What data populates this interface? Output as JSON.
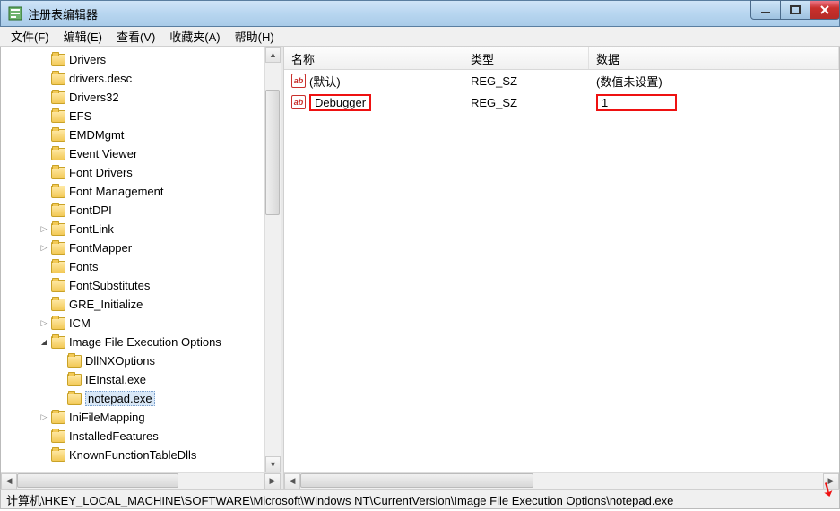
{
  "window": {
    "title": "注册表编辑器"
  },
  "menu": {
    "file": "文件(F)",
    "edit": "编辑(E)",
    "view": "查看(V)",
    "favorites": "收藏夹(A)",
    "help": "帮助(H)"
  },
  "tree": {
    "items": [
      {
        "indent": 2,
        "toggle": "none",
        "label": "Drivers"
      },
      {
        "indent": 2,
        "toggle": "none",
        "label": "drivers.desc"
      },
      {
        "indent": 2,
        "toggle": "none",
        "label": "Drivers32"
      },
      {
        "indent": 2,
        "toggle": "none",
        "label": "EFS"
      },
      {
        "indent": 2,
        "toggle": "none",
        "label": "EMDMgmt"
      },
      {
        "indent": 2,
        "toggle": "none",
        "label": "Event Viewer"
      },
      {
        "indent": 2,
        "toggle": "none",
        "label": "Font Drivers"
      },
      {
        "indent": 2,
        "toggle": "none",
        "label": "Font Management"
      },
      {
        "indent": 2,
        "toggle": "none",
        "label": "FontDPI"
      },
      {
        "indent": 2,
        "toggle": "collapsed",
        "label": "FontLink"
      },
      {
        "indent": 2,
        "toggle": "collapsed",
        "label": "FontMapper"
      },
      {
        "indent": 2,
        "toggle": "none",
        "label": "Fonts"
      },
      {
        "indent": 2,
        "toggle": "none",
        "label": "FontSubstitutes"
      },
      {
        "indent": 2,
        "toggle": "none",
        "label": "GRE_Initialize"
      },
      {
        "indent": 2,
        "toggle": "collapsed",
        "label": "ICM"
      },
      {
        "indent": 2,
        "toggle": "expanded",
        "label": "Image File Execution Options"
      },
      {
        "indent": 3,
        "toggle": "none",
        "label": "DllNXOptions"
      },
      {
        "indent": 3,
        "toggle": "none",
        "label": "IEInstal.exe"
      },
      {
        "indent": 3,
        "toggle": "none",
        "label": "notepad.exe",
        "selected": true
      },
      {
        "indent": 2,
        "toggle": "collapsed",
        "label": "IniFileMapping"
      },
      {
        "indent": 2,
        "toggle": "none",
        "label": "InstalledFeatures"
      },
      {
        "indent": 2,
        "toggle": "none",
        "label": "KnownFunctionTableDlls"
      }
    ]
  },
  "columns": {
    "name": "名称",
    "type": "类型",
    "data": "数据"
  },
  "values": [
    {
      "name": "(默认)",
      "type": "REG_SZ",
      "data": "(数值未设置)",
      "highlight_name": false,
      "highlight_data": false
    },
    {
      "name": "Debugger",
      "type": "REG_SZ",
      "data": "1",
      "highlight_name": true,
      "highlight_data": true
    }
  ],
  "statusbar": {
    "path": "计算机\\HKEY_LOCAL_MACHINE\\SOFTWARE\\Microsoft\\Windows NT\\CurrentVersion\\Image File Execution Options\\notepad.exe"
  }
}
